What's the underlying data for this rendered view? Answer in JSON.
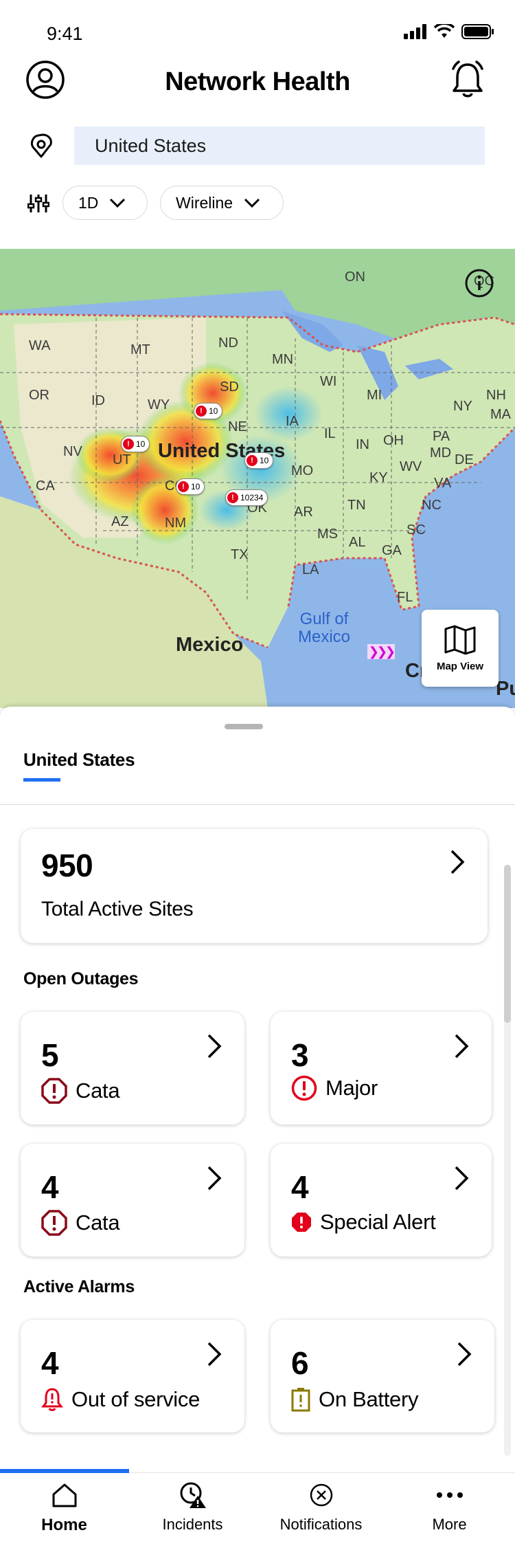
{
  "status_bar": {
    "time": "9:41"
  },
  "header": {
    "title": "Network Health"
  },
  "location": {
    "value": "United States"
  },
  "filters": {
    "period": "1D",
    "network": "Wireline"
  },
  "map": {
    "states": [
      "WA",
      "MT",
      "ND",
      "MN",
      "OR",
      "ID",
      "SD",
      "WI",
      "MI",
      "NY",
      "NH",
      "MA",
      "NV",
      "UT",
      "NE",
      "IA",
      "IL",
      "IN",
      "OH",
      "PA",
      "MD",
      "DE",
      "CA",
      "CO",
      "MO",
      "KY",
      "WV",
      "VA",
      "AZ",
      "NM",
      "OK",
      "AR",
      "TN",
      "NC",
      "SC",
      "MS",
      "AL",
      "GA",
      "TX",
      "LA",
      "FL",
      "WY",
      "ON",
      "QC"
    ],
    "country_labels": {
      "us": "United States",
      "mexico": "Mexico"
    },
    "water_label": "Gulf of Mexico",
    "edge_labels": {
      "cuba": "Cr",
      "pr": "Pu"
    },
    "pins": [
      "10",
      "10",
      "10",
      "10",
      "10234"
    ],
    "map_view_label": "Map View"
  },
  "sheet": {
    "tab_label": "United States",
    "total_sites": {
      "value": "950",
      "label": "Total Active Sites"
    },
    "open_outages_title": "Open Outages",
    "open_outages": [
      {
        "value": "5",
        "label": "Cata",
        "icon": "octagon-exclamation-icon",
        "color": "#8b0a1a"
      },
      {
        "value": "3",
        "label": "Major",
        "icon": "circle-exclamation-icon",
        "color": "#e3001b"
      },
      {
        "value": "4",
        "label": "Cata",
        "icon": "octagon-exclamation-icon",
        "color": "#8b0a1a"
      },
      {
        "value": "4",
        "label": "Special Alert",
        "icon": "octagon-filled-icon",
        "color": "#e3001b"
      }
    ],
    "active_alarms_title": "Active Alarms",
    "active_alarms": [
      {
        "value": "4",
        "label": "Out of service",
        "icon": "bell-alert-icon",
        "color": "#e3001b"
      },
      {
        "value": "6",
        "label": "On Battery",
        "icon": "battery-alert-icon",
        "color": "#8a7a00"
      }
    ]
  },
  "bottom_nav": [
    {
      "label": "Home",
      "icon": "home-icon",
      "active": true
    },
    {
      "label": "Incidents",
      "icon": "incidents-icon",
      "active": false
    },
    {
      "label": "Notifications",
      "icon": "notifications-icon",
      "active": false
    },
    {
      "label": "More",
      "icon": "more-icon",
      "active": false
    }
  ],
  "colors": {
    "accent": "#1f6ff0",
    "input_bg": "#e8effb",
    "critical": "#e3001b"
  }
}
